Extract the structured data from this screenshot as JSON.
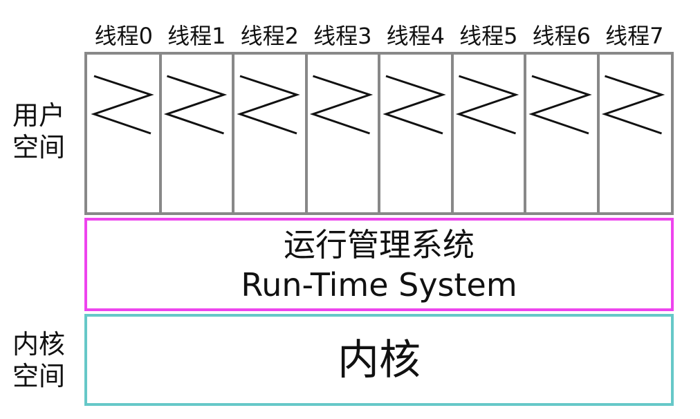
{
  "threads": [
    "线程0",
    "线程1",
    "线程2",
    "线程3",
    "线程4",
    "线程5",
    "线程6",
    "线程7"
  ],
  "user_space": {
    "label": "用户\n空间"
  },
  "runtime": {
    "title_zh": "运行管理系统",
    "title_en": "Run-Time System"
  },
  "kernel_space": {
    "label": "内核\n空间",
    "title": "内核"
  },
  "colors": {
    "grid_border": "#888888",
    "runtime_border": "#ee44ee",
    "kernel_border": "#66c8c8",
    "zigzag": "#111111"
  }
}
